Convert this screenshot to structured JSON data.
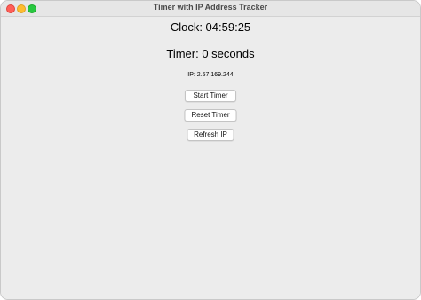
{
  "window": {
    "title": "Timer with IP Address Tracker"
  },
  "clock": {
    "text": "Clock: 04:59:25"
  },
  "timer": {
    "text": "Timer: 0 seconds"
  },
  "ip": {
    "text": "IP: 2.57.169.244"
  },
  "buttons": {
    "start": "Start Timer",
    "reset": "Reset Timer",
    "refresh": "Refresh IP"
  },
  "icons": {
    "close": "close-icon",
    "minimize": "minimize-icon",
    "maximize": "maximize-icon"
  },
  "colors": {
    "close": "#ff5f57",
    "minimize": "#febc2e",
    "maximize": "#28c840",
    "background": "#ececec"
  }
}
